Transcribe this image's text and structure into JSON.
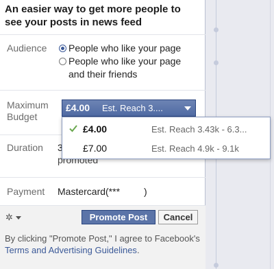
{
  "headline": "An easier way to get more people to see your posts in news feed",
  "audience": {
    "label": "Audience",
    "options": [
      {
        "line1": "People who like your page",
        "line2": "",
        "selected": true
      },
      {
        "line1": "People who like your page",
        "line2": "and their friends",
        "selected": false
      }
    ]
  },
  "budget": {
    "label_line1": "Maximum",
    "label_line2": "Budget",
    "selected_amount": "£4.00",
    "selected_reach": "Est. Reach 3....",
    "menu": [
      {
        "amount": "£4.00",
        "reach": "Est. Reach 3.43k - 6.3...",
        "checked": true
      },
      {
        "amount": "£7.00",
        "reach": "Est. Reach 4.9k - 9.1k",
        "checked": false
      }
    ]
  },
  "duration": {
    "label": "Duration",
    "value_visible": "3",
    "hidden_text": "promoted"
  },
  "payment": {
    "label": "Payment",
    "value": "Mastercard(***         )"
  },
  "footer": {
    "promote_label": "Promote Post",
    "cancel_label": "Cancel",
    "legal_prefix": "By clicking \"Promote Post,\" I agree to Facebook's ",
    "legal_link": "Terms and Advertising Guidelines",
    "legal_suffix": "."
  },
  "colors": {
    "accent": "#3b5998",
    "button": "#5b74a8",
    "checkmark": "#6aa84f"
  }
}
